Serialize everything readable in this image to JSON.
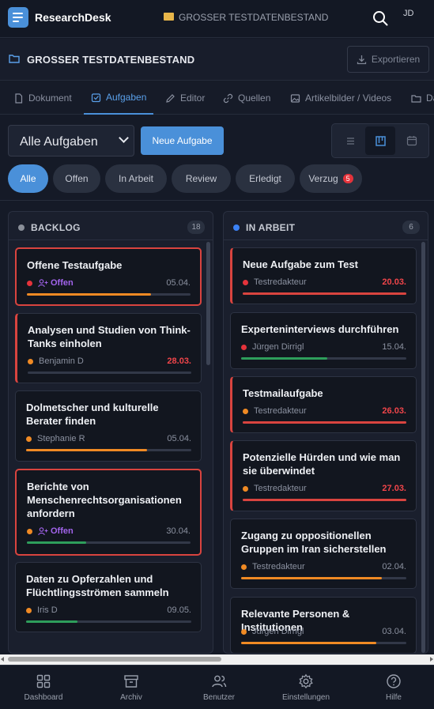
{
  "app": {
    "brand": "ResearchDesk",
    "user_initials": "JD"
  },
  "breadcrumb": {
    "project": "GROSSER TESTDATENBESTAND"
  },
  "project": {
    "title": "GROSSER TESTDATENBESTAND",
    "export_label": "Exportieren"
  },
  "tabs": [
    {
      "label": "Dokument"
    },
    {
      "label": "Aufgaben",
      "active": true
    },
    {
      "label": "Editor"
    },
    {
      "label": "Quellen"
    },
    {
      "label": "Artikelbilder / Videos"
    },
    {
      "label": "Da"
    }
  ],
  "filters": {
    "select_value": "Alle Aufgaben",
    "new_task_label": "Neue Aufgabe",
    "chips": [
      {
        "label": "Alle",
        "active": true
      },
      {
        "label": "Offen"
      },
      {
        "label": "In Arbeit"
      },
      {
        "label": "Review"
      },
      {
        "label": "Erledigt"
      },
      {
        "label": "Verzug",
        "badge": "5"
      }
    ]
  },
  "colors": {
    "accent": "#4a90d9",
    "overdue": "#f0454a",
    "open": "#a264ec",
    "progress_orange": "#f08a24",
    "progress_red": "#d9443f",
    "progress_green": "#2e9e5b"
  },
  "columns": [
    {
      "title": "BACKLOG",
      "count": "18",
      "dot_color": "#8a8f99",
      "cards": [
        {
          "title": "Offene Testaufgabe",
          "assignee": "Offen",
          "open": true,
          "date": "05.04.",
          "overdue": false,
          "status_color": "#e5333b",
          "progress": 0.76,
          "bar_color": "#f08a24",
          "style": "alert"
        },
        {
          "title": "Analysen und Studien von Think-Tanks einholen",
          "assignee": "Benjamin D",
          "open": false,
          "date": "28.03.",
          "overdue": true,
          "status_color": "#f08a24",
          "progress": 0.0,
          "bar_color": "#f08a24",
          "style": "leftalert"
        },
        {
          "title": "Dolmetscher und kulturelle Berater finden",
          "assignee": "Stephanie R",
          "open": false,
          "date": "05.04.",
          "overdue": false,
          "status_color": "#f08a24",
          "progress": 0.73,
          "bar_color": "#f08a24",
          "style": "normal"
        },
        {
          "title": "Berichte von Menschenrechtsorganisationen anfordern",
          "assignee": "Offen",
          "open": true,
          "date": "30.04.",
          "overdue": false,
          "status_color": "#f08a24",
          "progress": 0.36,
          "bar_color": "#2e9e5b",
          "style": "alert"
        },
        {
          "title": "Daten zu Opferzahlen und Flüchtlingsströmen sammeln",
          "assignee": "Iris D",
          "open": false,
          "date": "09.05.",
          "overdue": false,
          "status_color": "#f08a24",
          "progress": 0.31,
          "bar_color": "#2e9e5b",
          "style": "normal"
        }
      ]
    },
    {
      "title": "IN ARBEIT",
      "count": "6",
      "dot_color": "#3b82f6",
      "cards": [
        {
          "title": "Neue Aufgabe zum Test",
          "assignee": "Testredakteur",
          "open": false,
          "date": "20.03.",
          "overdue": true,
          "status_color": "#e5333b",
          "progress": 1.0,
          "bar_color": "#d9443f",
          "style": "leftalert"
        },
        {
          "title": "Experteninterviews durchführen",
          "assignee": "Jürgen Dirrigl",
          "open": false,
          "date": "15.04.",
          "overdue": false,
          "status_color": "#e5333b",
          "progress": 0.52,
          "bar_color": "#2e9e5b",
          "style": "normal"
        },
        {
          "title": "Testmailaufgabe",
          "assignee": "Testredakteur",
          "open": false,
          "date": "26.03.",
          "overdue": true,
          "status_color": "#f08a24",
          "progress": 1.0,
          "bar_color": "#d9443f",
          "style": "leftalert"
        },
        {
          "title": "Potenzielle Hürden und wie man sie überwindet",
          "assignee": "Testredakteur",
          "open": false,
          "date": "27.03.",
          "overdue": true,
          "status_color": "#f08a24",
          "progress": 1.0,
          "bar_color": "#d9443f",
          "style": "leftalert"
        },
        {
          "title": "Zugang zu oppositionellen Gruppen im Iran sicherstellen",
          "assignee": "Testredakteur",
          "open": false,
          "date": "02.04.",
          "overdue": false,
          "status_color": "#f08a24",
          "progress": 0.85,
          "bar_color": "#f08a24",
          "style": "normal"
        },
        {
          "title": "Relevante Personen & Institutionen",
          "assignee": "Jürgen Dirrigl",
          "open": false,
          "date": "03.04.",
          "overdue": false,
          "status_color": "#f08a24",
          "progress": 0.82,
          "bar_color": "#f08a24",
          "style": "normal"
        }
      ]
    }
  ],
  "bottom_nav": [
    {
      "label": "Dashboard",
      "icon": "grid-icon"
    },
    {
      "label": "Archiv",
      "icon": "archive-icon"
    },
    {
      "label": "Benutzer",
      "icon": "users-icon"
    },
    {
      "label": "Einstellungen",
      "icon": "gear-icon"
    },
    {
      "label": "Hilfe",
      "icon": "help-icon"
    }
  ]
}
